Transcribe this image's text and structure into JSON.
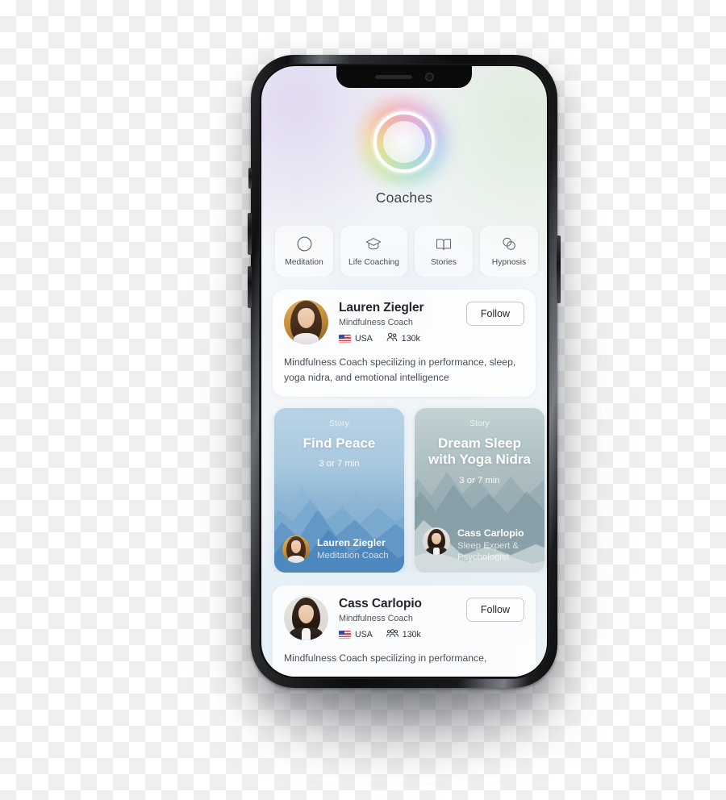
{
  "app": {
    "title": "Coaches",
    "logo_icon": "rainbow-ring-logo"
  },
  "categories": [
    {
      "label": "Meditation",
      "icon": "circle-icon"
    },
    {
      "label": "Life Coaching",
      "icon": "graduation-cap-icon"
    },
    {
      "label": "Stories",
      "icon": "open-book-icon"
    },
    {
      "label": "Hypnosis",
      "icon": "overlapping-circles-icon"
    },
    {
      "label": "",
      "icon": ""
    }
  ],
  "coaches": [
    {
      "name": "Lauren Ziegler",
      "role": "Mindfulness Coach",
      "country": "USA",
      "country_icon": "usa-flag-icon",
      "followers": "130k",
      "followers_icon": "people-icon",
      "bio": "Mindfulness Coach specilizing in performance, sleep, yoga nidra, and emotional intelligence",
      "follow_label": "Follow",
      "avatar": "lauren-avatar"
    },
    {
      "name": "Cass Carlopio",
      "role": "Mindfulness Coach",
      "country": "USA",
      "country_icon": "usa-flag-icon",
      "followers": "130k",
      "followers_icon": "people-group-icon",
      "bio": "Mindfulness Coach specilizing in performance,",
      "follow_label": "Follow",
      "avatar": "cass-avatar"
    }
  ],
  "stories": [
    {
      "kicker": "Story",
      "title": "Find Peace",
      "duration": "3 or 7 min",
      "author_name": "Lauren Ziegler",
      "author_role": "Meditation Coach",
      "avatar": "lauren-avatar",
      "theme": "blue-mountains"
    },
    {
      "kicker": "Story",
      "title": "Dream Sleep with Yoga Nidra",
      "duration": "3 or 7 min",
      "author_name": "Cass Carlopio",
      "author_role": "Sleep Expert & Psychologist",
      "avatar": "cass-avatar",
      "theme": "grey-mountains"
    }
  ],
  "colors": {
    "title_text": "#3b4149",
    "coach_name": "#22262c",
    "body_text": "#474d56",
    "card_bg": "#ffffff",
    "story_blue": "#86b0d2",
    "story_grey": "#a4b6ba",
    "device_frame": "#17181a"
  }
}
